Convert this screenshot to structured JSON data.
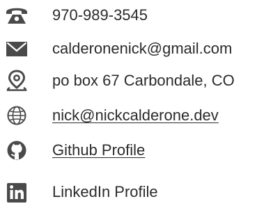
{
  "contact": {
    "phone": {
      "text": "970-989-3545",
      "icon": "phone-icon"
    },
    "email": {
      "text": "calderonenick@gmail.com",
      "icon": "envelope-icon"
    },
    "address": {
      "text": "po box 67 Carbondale, CO",
      "icon": "map-pin-icon"
    },
    "website": {
      "text": "nick@nickcalderone.dev",
      "icon": "globe-icon"
    },
    "github": {
      "text": "Github Profile",
      "icon": "github-icon"
    },
    "linkedin": {
      "text": "LinkedIn Profile",
      "icon": "linkedin-icon"
    }
  },
  "colors": {
    "icon": "#4a4a4a",
    "text": "#2b2b2b",
    "background": "#ffffff"
  }
}
